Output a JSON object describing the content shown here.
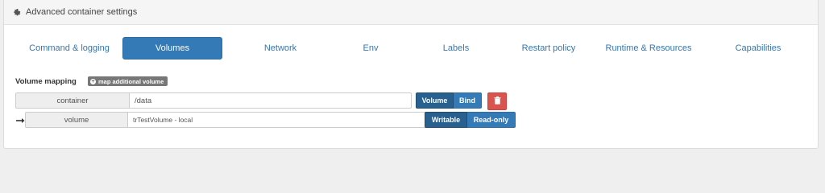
{
  "header": {
    "title": "Advanced container settings",
    "icon": "gear-icon"
  },
  "tabs": [
    {
      "label": "Command & logging",
      "active": false
    },
    {
      "label": "Volumes",
      "active": true
    },
    {
      "label": "Network",
      "active": false
    },
    {
      "label": "Env",
      "active": false
    },
    {
      "label": "Labels",
      "active": false
    },
    {
      "label": "Restart policy",
      "active": false
    },
    {
      "label": "Runtime & Resources",
      "active": false
    },
    {
      "label": "Capabilities",
      "active": false
    }
  ],
  "volume_mapping": {
    "label": "Volume mapping",
    "add_button": "map additional volume",
    "row": {
      "container_label": "container",
      "container_value": "/data",
      "type_options": [
        "Volume",
        "Bind"
      ],
      "selected_type": "Volume",
      "volume_label": "volume",
      "volume_value": "trTestVolume - local",
      "mode_options": [
        "Writable",
        "Read-only"
      ],
      "selected_mode": "Writable"
    }
  },
  "colors": {
    "primary": "#337ab7",
    "primary_active": "#286090",
    "danger": "#d9534f",
    "default": "#777777"
  }
}
